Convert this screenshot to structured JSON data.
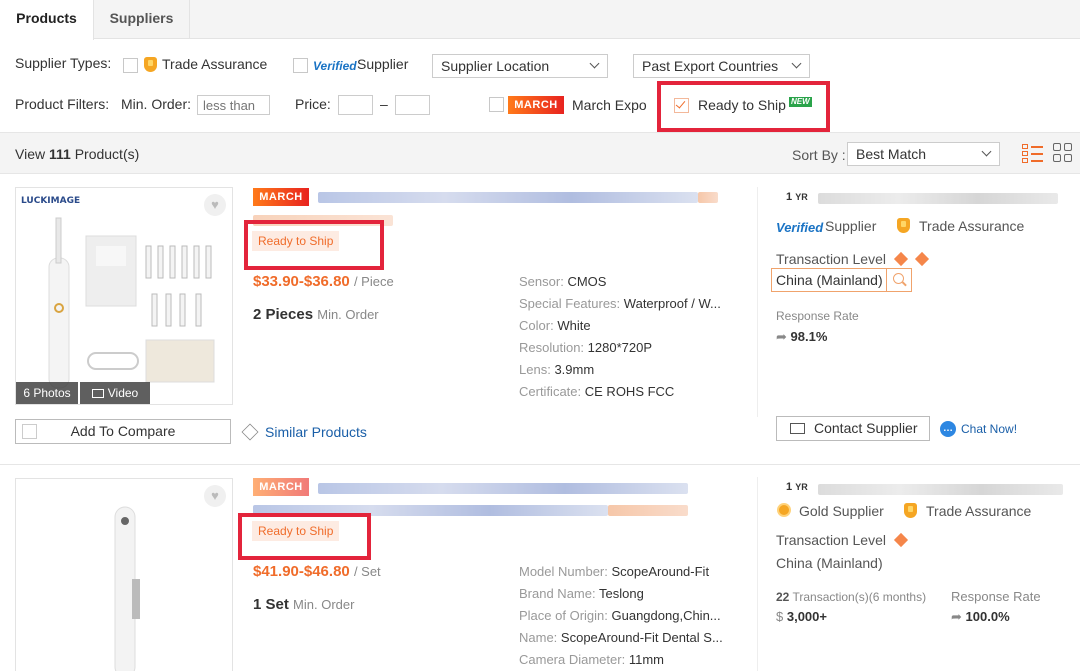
{
  "tabs": {
    "products": "Products",
    "suppliers": "Suppliers"
  },
  "filters": {
    "supplier_types_label": "Supplier Types:",
    "trade_assurance": "Trade Assurance",
    "verified_badge": "Verified",
    "verified_supplier": "Supplier",
    "supplier_location": "Supplier Location",
    "past_export": "Past Export Countries",
    "product_filters_label": "Product Filters:",
    "min_order_label": "Min. Order:",
    "min_order_placeholder": "less than",
    "price_label": "Price:",
    "price_dash": "–",
    "march_badge": "MARCH",
    "march_expo": "March Expo",
    "ready_to_ship": "Ready to Ship",
    "new_badge": "NEW"
  },
  "results": {
    "view": "View",
    "count": "111",
    "products": "Product(s)",
    "sort_by": "Sort By :",
    "sort_value": "Best Match"
  },
  "products": [
    {
      "march_badge": "MARCH",
      "ready_to_ship": "Ready to Ship",
      "price": "$33.90-$36.80",
      "unit": "/ Piece",
      "moq_value": "2 Pieces",
      "moq_label": "Min. Order",
      "photos": "6 Photos",
      "video": "Video",
      "logo_text": "LUCKIMAGE",
      "attrs": [
        {
          "k": "Sensor:",
          "v": "CMOS"
        },
        {
          "k": "Special Features:",
          "v": "Waterproof / W..."
        },
        {
          "k": "Color:",
          "v": "White"
        },
        {
          "k": "Resolution:",
          "v": "1280*720P"
        },
        {
          "k": "Lens:",
          "v": "3.9mm"
        },
        {
          "k": "Certificate:",
          "v": "CE ROHS FCC"
        }
      ],
      "yr": "1",
      "yr_unit": "YR",
      "verified_badge": "Verified",
      "supplier": "Supplier",
      "trade_assurance": "Trade Assurance",
      "transaction_level": "Transaction Level",
      "location": "China (Mainland)",
      "response_rate_label": "Response Rate",
      "response_rate": "98.1%",
      "add_compare": "Add To Compare",
      "similar": "Similar Products",
      "contact": "Contact Supplier",
      "chat": "Chat Now!"
    },
    {
      "march_badge": "MARCH",
      "ready_to_ship": "Ready to Ship",
      "price": "$41.90-$46.80",
      "unit": "/ Set",
      "moq_value": "1 Set",
      "moq_label": "Min. Order",
      "attrs": [
        {
          "k": "Model Number:",
          "v": "ScopeAround-Fit"
        },
        {
          "k": "Brand Name:",
          "v": "Teslong"
        },
        {
          "k": "Place of Origin:",
          "v": "Guangdong,Chin..."
        },
        {
          "k": "Name:",
          "v": "ScopeAround-Fit Dental S..."
        },
        {
          "k": "Camera Diameter:",
          "v": "11mm"
        }
      ],
      "yr": "1",
      "yr_unit": "YR",
      "gold_supplier": "Gold Supplier",
      "trade_assurance": "Trade Assurance",
      "transaction_level": "Transaction Level",
      "location": "China (Mainland)",
      "transactions_count": "22",
      "transactions_label": "Transaction(s)(6 months)",
      "transactions_value": "3,000+",
      "response_rate_label": "Response Rate",
      "response_rate": "100.0%"
    }
  ],
  "colors": {
    "accent": "#f06c2a",
    "highlight": "#e3243b",
    "link": "#1a5fa8",
    "verified": "#1a73c4"
  }
}
